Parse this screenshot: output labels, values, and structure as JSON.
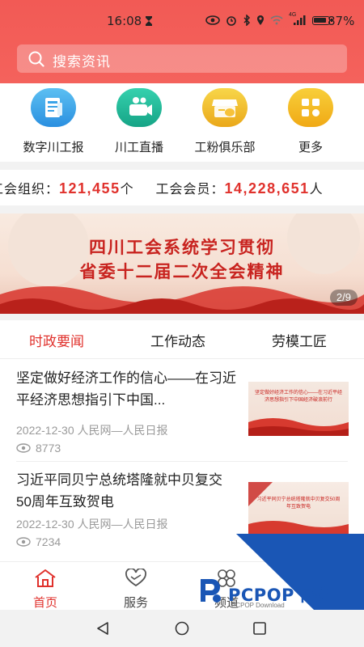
{
  "status_bar": {
    "time": "16:08",
    "battery_percent": "87%",
    "network_label": "4G"
  },
  "search": {
    "placeholder": "搜索资讯"
  },
  "quick_nav": [
    {
      "label": "数字川工报",
      "icon": "newspaper-icon",
      "color": "#3aa3e8"
    },
    {
      "label": "川工直播",
      "icon": "video-camera-icon",
      "color": "#22b79a"
    },
    {
      "label": "工粉俱乐部",
      "icon": "store-icon",
      "color": "#f1c12f"
    },
    {
      "label": "更多",
      "icon": "grid-more-icon",
      "color": "#f4bd20"
    }
  ],
  "ticker": {
    "org_label": "工会组织：",
    "org_value": "121,455",
    "org_unit": "个",
    "member_label": "工会会员：",
    "member_value": "14,228,651",
    "member_unit": "人"
  },
  "banner": {
    "line1": "四川工会系统学习贯彻",
    "line2": "省委十二届二次全会精神",
    "counter": "2/9"
  },
  "tabs": [
    {
      "label": "时政要闻",
      "active": true
    },
    {
      "label": "工作动态",
      "active": false
    },
    {
      "label": "劳模工匠",
      "active": false
    }
  ],
  "news": [
    {
      "title": "坚定做好经济工作的信心——在习近平经济思想指引下中国...",
      "date": "2022-12-30",
      "source": "人民网—人民日报",
      "views": "8773",
      "thumb_text": "坚定做好经济工作的信心——在习近平经济思想指引下中国经济破浪前行"
    },
    {
      "title": "习近平同贝宁总统塔隆就中贝复交50周年互致贺电",
      "date": "2022-12-30",
      "source": "人民网—人民日报",
      "views": "7234",
      "thumb_text": "习近平同贝宁总统塔隆就中贝复交50周年互致贺电"
    }
  ],
  "bottom_nav": [
    {
      "label": "首页",
      "icon": "home-icon",
      "active": true
    },
    {
      "label": "服务",
      "icon": "heart-icon",
      "active": false
    },
    {
      "label": "频道",
      "icon": "channel-icon",
      "active": false
    }
  ],
  "watermark": {
    "text": "PCPOP下载",
    "sub": "PCPOP Download"
  },
  "colors": {
    "brand_red": "#f25a55",
    "accent_red": "#e0312c"
  }
}
